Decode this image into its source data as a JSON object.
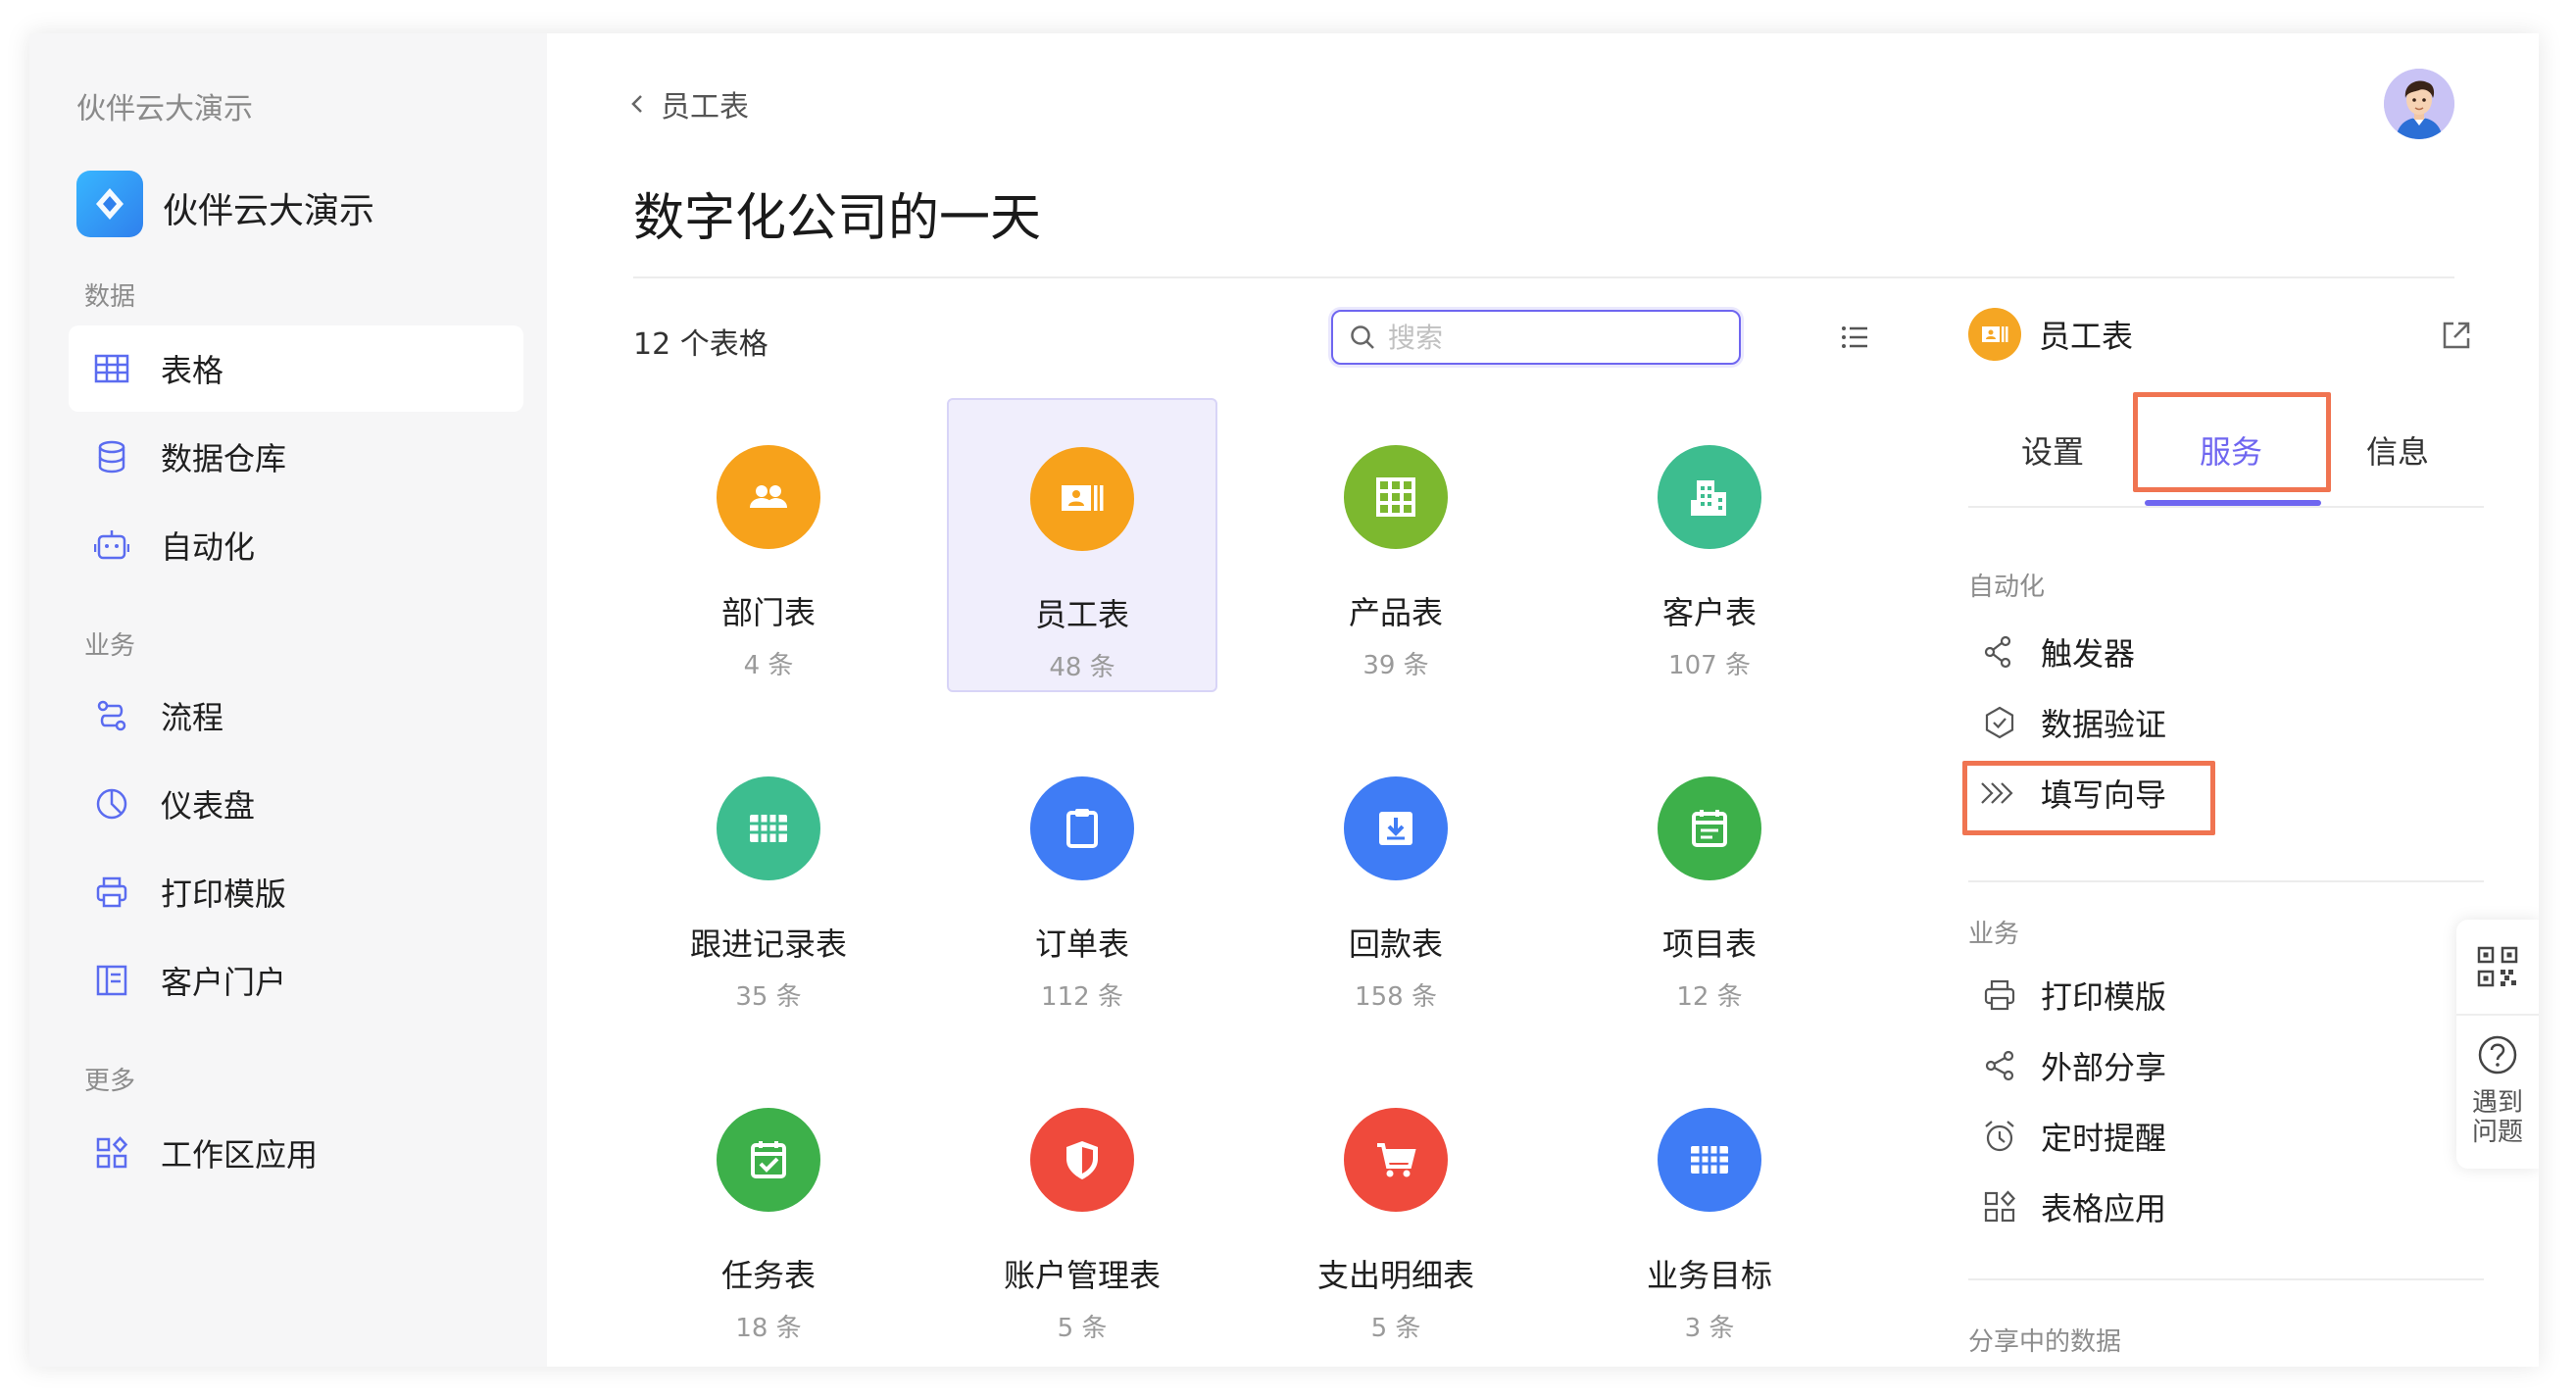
{
  "sidebar": {
    "workspace_name": "伙伴云大演示",
    "app_title": "伙伴云大演示",
    "sections": {
      "data": "数据",
      "business": "业务",
      "more": "更多"
    },
    "items": [
      {
        "label": "表格",
        "icon": "table-icon",
        "active": true
      },
      {
        "label": "数据仓库",
        "icon": "database-icon"
      },
      {
        "label": "自动化",
        "icon": "robot-icon"
      },
      {
        "label": "流程",
        "icon": "flow-icon"
      },
      {
        "label": "仪表盘",
        "icon": "dashboard-icon"
      },
      {
        "label": "打印模版",
        "icon": "printer-icon"
      },
      {
        "label": "客户门户",
        "icon": "portal-icon"
      },
      {
        "label": "工作区应用",
        "icon": "apps-icon"
      }
    ]
  },
  "header": {
    "breadcrumb": "员工表",
    "page_title": "数字化公司的一天"
  },
  "toolbar": {
    "count_label": "12 个表格",
    "search_placeholder": "搜索"
  },
  "tables": [
    {
      "name": "部门表",
      "count": "4 条",
      "color": "#f7a21b",
      "icon": "people-icon"
    },
    {
      "name": "员工表",
      "count": "48 条",
      "color": "#f7a21b",
      "icon": "id-card-icon",
      "selected": true
    },
    {
      "name": "产品表",
      "count": "39 条",
      "color": "#7cb82f",
      "icon": "grid-icon"
    },
    {
      "name": "客户表",
      "count": "107 条",
      "color": "#3dbd8f",
      "icon": "building-icon"
    },
    {
      "name": "跟进记录表",
      "count": "35 条",
      "color": "#3dbd8f",
      "icon": "sheet-icon"
    },
    {
      "name": "订单表",
      "count": "112 条",
      "color": "#3f7cf5",
      "icon": "clipboard-icon"
    },
    {
      "name": "回款表",
      "count": "158 条",
      "color": "#3f7cf5",
      "icon": "download-box-icon"
    },
    {
      "name": "项目表",
      "count": "12 条",
      "color": "#3db04a",
      "icon": "calendar-icon"
    },
    {
      "name": "任务表",
      "count": "18 条",
      "color": "#3db04a",
      "icon": "calendar-check-icon"
    },
    {
      "name": "账户管理表",
      "count": "5 条",
      "color": "#ef4a3c",
      "icon": "shield-icon"
    },
    {
      "name": "支出明细表",
      "count": "5 条",
      "color": "#ef4a3c",
      "icon": "cart-icon"
    },
    {
      "name": "业务目标",
      "count": "3 条",
      "color": "#3f7cf5",
      "icon": "grid-icon"
    }
  ],
  "panel": {
    "title": "员工表",
    "tabs": [
      "设置",
      "服务",
      "信息"
    ],
    "active_tab": "服务",
    "sections": {
      "automation": "自动化",
      "business": "业务",
      "shared": "分享中的数据"
    },
    "automation_items": [
      {
        "label": "触发器",
        "icon": "trigger-icon"
      },
      {
        "label": "数据验证",
        "icon": "validate-icon"
      },
      {
        "label": "填写向导",
        "icon": "wizard-icon"
      }
    ],
    "business_items": [
      {
        "label": "打印模版",
        "icon": "printer-icon"
      },
      {
        "label": "外部分享",
        "icon": "share-icon"
      },
      {
        "label": "定时提醒",
        "icon": "alarm-icon"
      },
      {
        "label": "表格应用",
        "icon": "apps-icon"
      }
    ]
  },
  "float_tools": {
    "help_label": "遇到\n问题"
  },
  "colors": {
    "accent": "#6f66f0",
    "highlight": "#f07451"
  }
}
